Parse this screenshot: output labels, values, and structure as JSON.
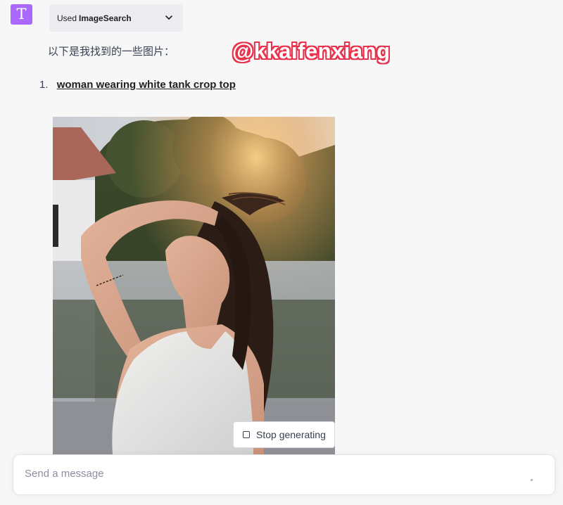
{
  "avatar": {
    "letter": "T",
    "color": "#ab68ff"
  },
  "plugin": {
    "used_label": "Used",
    "name": "ImageSearch",
    "toggle_icon": "chevron-down-icon"
  },
  "message": {
    "intro": "以下是我找到的一些图片：",
    "items": [
      {
        "number": "1.",
        "link_text": "woman wearing white tank crop top"
      }
    ]
  },
  "watermark": {
    "text": "@kkaifenxiang",
    "stroke_color": "#e8344e"
  },
  "stop_button": {
    "label": "Stop generating",
    "icon": "stop-square-icon"
  },
  "composer": {
    "placeholder": "Send a message",
    "value": ""
  },
  "colors": {
    "background": "#f7f7f8",
    "pill": "#ececf1",
    "text": "#374151"
  }
}
